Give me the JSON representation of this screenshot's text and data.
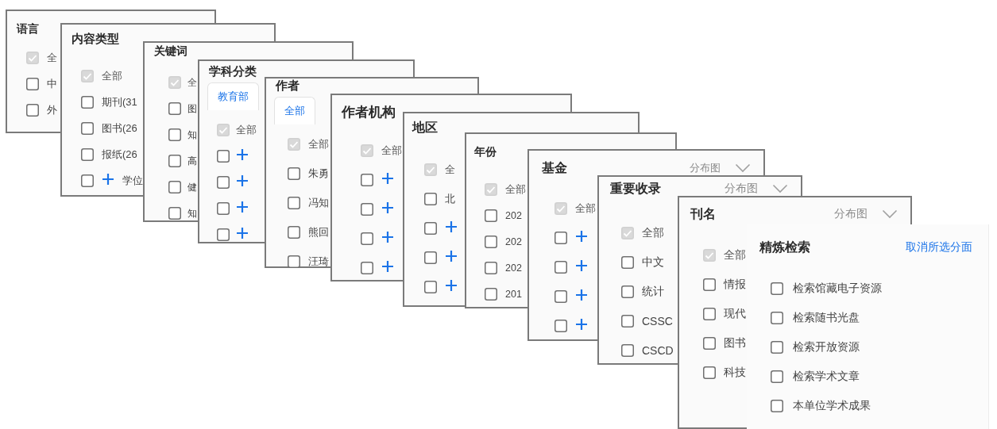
{
  "facet_cards": [
    {
      "title": "语言",
      "items": [
        {
          "kind": "option",
          "label": "全",
          "checked": true,
          "disabled": true
        },
        {
          "kind": "option",
          "label": "中",
          "checked": false,
          "disabled": false
        },
        {
          "kind": "option",
          "label": "外",
          "checked": false,
          "disabled": false
        }
      ]
    },
    {
      "title": "内容类型",
      "items": [
        {
          "kind": "option",
          "label": "全部",
          "checked": true,
          "disabled": true
        },
        {
          "kind": "option",
          "label": "期刊(31",
          "checked": false,
          "disabled": false
        },
        {
          "kind": "option",
          "label": "图书(26",
          "checked": false,
          "disabled": false
        },
        {
          "kind": "option",
          "label": "报纸(26",
          "checked": false,
          "disabled": false
        },
        {
          "kind": "group",
          "label": "学位",
          "checked": false,
          "disabled": false
        }
      ]
    },
    {
      "title": "关键词",
      "items": [
        {
          "kind": "option",
          "label": "全",
          "checked": true,
          "disabled": true
        },
        {
          "kind": "option",
          "label": "图",
          "checked": false,
          "disabled": false
        },
        {
          "kind": "option",
          "label": "知",
          "checked": false,
          "disabled": false
        },
        {
          "kind": "option",
          "label": "高",
          "checked": false,
          "disabled": false
        },
        {
          "kind": "option",
          "label": "健",
          "checked": false,
          "disabled": false
        },
        {
          "kind": "option",
          "label": "知",
          "checked": false,
          "disabled": false
        }
      ]
    },
    {
      "title": "学科分类",
      "tabs": [
        {
          "label": "教育部",
          "selected": true
        }
      ],
      "items": [
        {
          "kind": "option",
          "label": "全部",
          "checked": true,
          "disabled": true
        },
        {
          "kind": "group",
          "checked": false,
          "disabled": false
        },
        {
          "kind": "group",
          "checked": false,
          "disabled": false
        },
        {
          "kind": "group",
          "checked": false,
          "disabled": false
        },
        {
          "kind": "group",
          "checked": false,
          "disabled": false
        }
      ]
    },
    {
      "title": "作者",
      "tabs": [
        {
          "label": "全部",
          "selected": true
        }
      ],
      "items": [
        {
          "kind": "option",
          "label": "全部",
          "checked": true,
          "disabled": true
        },
        {
          "kind": "option",
          "label": "朱勇",
          "checked": false,
          "disabled": false
        },
        {
          "kind": "option",
          "label": "冯知",
          "checked": false,
          "disabled": false
        },
        {
          "kind": "option",
          "label": "熊回",
          "checked": false,
          "disabled": false
        },
        {
          "kind": "option",
          "label": "汪琦",
          "checked": false,
          "disabled": false
        }
      ]
    },
    {
      "title": "作者机构",
      "items": [
        {
          "kind": "option",
          "label": "全部",
          "checked": true,
          "disabled": true
        },
        {
          "kind": "group",
          "checked": false,
          "disabled": false
        },
        {
          "kind": "group",
          "checked": false,
          "disabled": false
        },
        {
          "kind": "group",
          "checked": false,
          "disabled": false
        },
        {
          "kind": "group",
          "checked": false,
          "disabled": false
        }
      ]
    },
    {
      "title": "地区",
      "items": [
        {
          "kind": "option",
          "label": "全",
          "checked": true,
          "disabled": true
        },
        {
          "kind": "option",
          "label": "北",
          "checked": false,
          "disabled": false
        },
        {
          "kind": "group",
          "checked": false,
          "disabled": false
        },
        {
          "kind": "group",
          "checked": false,
          "disabled": false
        },
        {
          "kind": "group",
          "checked": false,
          "disabled": false
        }
      ]
    },
    {
      "title": "年份",
      "items": [
        {
          "kind": "option",
          "label": "全部",
          "checked": true,
          "disabled": true
        },
        {
          "kind": "option",
          "label": "202",
          "checked": false,
          "disabled": false
        },
        {
          "kind": "option",
          "label": "202",
          "checked": false,
          "disabled": false
        },
        {
          "kind": "option",
          "label": "202",
          "checked": false,
          "disabled": false
        },
        {
          "kind": "option",
          "label": "201",
          "checked": false,
          "disabled": false
        }
      ]
    },
    {
      "title": "基金",
      "distribution_label": "分布图",
      "items": [
        {
          "kind": "option",
          "label": "全部",
          "checked": true,
          "disabled": true
        },
        {
          "kind": "group",
          "checked": false,
          "disabled": false
        },
        {
          "kind": "group",
          "checked": false,
          "disabled": false
        },
        {
          "kind": "group",
          "checked": false,
          "disabled": false
        },
        {
          "kind": "group",
          "checked": false,
          "disabled": false
        }
      ]
    },
    {
      "title": "重要收录",
      "distribution_label": "分布图",
      "items": [
        {
          "kind": "option",
          "label": "全部",
          "checked": true,
          "disabled": true
        },
        {
          "kind": "option",
          "label": "中文",
          "checked": false,
          "disabled": false
        },
        {
          "kind": "option",
          "label": "统计",
          "checked": false,
          "disabled": false
        },
        {
          "kind": "option",
          "label": "CSSC",
          "checked": false,
          "disabled": false
        },
        {
          "kind": "option",
          "label": "CSCD",
          "checked": false,
          "disabled": false
        }
      ]
    },
    {
      "title": "刊名",
      "distribution_label": "分布图",
      "items": [
        {
          "kind": "option",
          "label": "全部",
          "checked": true,
          "disabled": true
        },
        {
          "kind": "option",
          "label": "情报",
          "checked": false,
          "disabled": false
        },
        {
          "kind": "option",
          "label": "现代",
          "checked": false,
          "disabled": false
        },
        {
          "kind": "option",
          "label": "图书",
          "checked": false,
          "disabled": false
        },
        {
          "kind": "option",
          "label": "科技",
          "checked": false,
          "disabled": false
        }
      ]
    }
  ],
  "refine_panel": {
    "title": "精炼检索",
    "clear_link": "取消所选分面",
    "items": [
      {
        "label": "检索馆藏电子资源",
        "checked": false
      },
      {
        "label": "检索随书光盘",
        "checked": false
      },
      {
        "label": "检索开放资源",
        "checked": false
      },
      {
        "label": "检索学术文章",
        "checked": false
      },
      {
        "label": "本单位学术成果",
        "checked": false
      }
    ]
  }
}
